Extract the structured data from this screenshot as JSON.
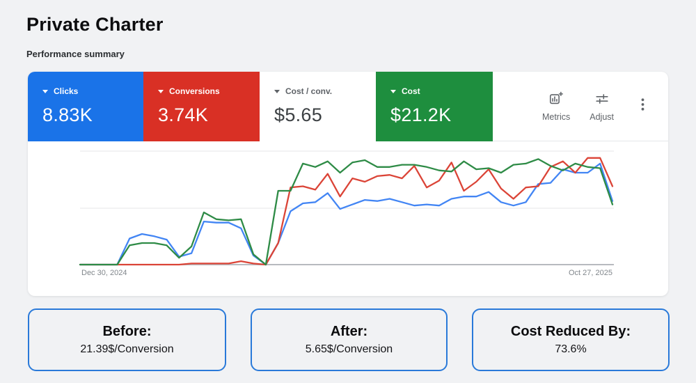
{
  "page": {
    "title": "Private Charter",
    "subtitle": "Performance summary"
  },
  "metric_cards": [
    {
      "label": "Clicks",
      "value": "8.83K",
      "bg": "#1a73e8",
      "text": "#ffffff"
    },
    {
      "label": "Conversions",
      "value": "3.74K",
      "bg": "#d93025",
      "text": "#ffffff"
    },
    {
      "label": "Cost / conv.",
      "value": "$5.65",
      "bg": "#ffffff",
      "text": "#3c4043"
    },
    {
      "label": "Cost",
      "value": "$21.2K",
      "bg": "#1e8e3e",
      "text": "#ffffff"
    }
  ],
  "toolbar": {
    "metrics_label": "Metrics",
    "adjust_label": "Adjust",
    "more_icon": "kebab-menu"
  },
  "chart_data": {
    "type": "line",
    "title": "Performance summary chart",
    "x_start_label": "Dec 30, 2024",
    "x_end_label": "Oct 27, 2025",
    "x_unit": "week",
    "n_points": 44,
    "ylabel": "",
    "y_note": "no y-axis ticks shown; values are relative height, 0 = baseline, 100 = top gridline",
    "ylim": [
      0,
      100
    ],
    "grid": {
      "lines_at": [
        100,
        50
      ],
      "baseline": 0,
      "legend": "none"
    },
    "series": [
      {
        "name": "Clicks",
        "color": "#4285f4",
        "values": [
          0,
          0,
          0,
          0,
          23,
          27,
          25,
          22,
          7,
          10,
          38,
          37,
          37,
          32,
          8,
          0,
          19,
          47,
          54,
          55,
          63,
          49,
          53,
          57,
          56,
          58,
          55,
          52,
          53,
          52,
          58,
          60,
          60,
          64,
          55,
          52,
          55,
          71,
          72,
          84,
          81,
          81,
          89,
          56
        ]
      },
      {
        "name": "Conversions",
        "color": "#db4437",
        "values": [
          0,
          0,
          0,
          0,
          0,
          0,
          0,
          0,
          0,
          1,
          1,
          1,
          1,
          3,
          1,
          0,
          19,
          68,
          69,
          66,
          80,
          60,
          76,
          73,
          78,
          79,
          76,
          87,
          68,
          74,
          90,
          65,
          73,
          84,
          67,
          58,
          68,
          69,
          86,
          91,
          81,
          94,
          94,
          69
        ]
      },
      {
        "name": "Cost",
        "color": "#2e8b46",
        "values": [
          0,
          0,
          0,
          0,
          17,
          19,
          19,
          17,
          6,
          16,
          46,
          40,
          39,
          40,
          9,
          0,
          65,
          65,
          89,
          86,
          91,
          81,
          90,
          92,
          86,
          86,
          88,
          88,
          86,
          83,
          82,
          91,
          84,
          85,
          81,
          88,
          89,
          93,
          87,
          83,
          89,
          86,
          85,
          53
        ]
      }
    ]
  },
  "summary_boxes": [
    {
      "title": "Before:",
      "value": "21.39$/Conversion"
    },
    {
      "title": "After:",
      "value": "5.65$/Conversion"
    },
    {
      "title": "Cost Reduced By:",
      "value": "73.6%"
    }
  ],
  "colors": {
    "accent_blue": "#1a73e8",
    "accent_red": "#d93025",
    "accent_green": "#1e8e3e",
    "box_border": "#2979d9",
    "gridline": "#e9eaec",
    "baseline": "#b7babf",
    "icon_gray": "#5f6368",
    "page_bg": "#f1f2f4"
  }
}
